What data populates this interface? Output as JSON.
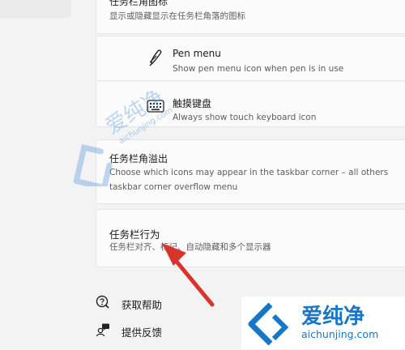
{
  "top_item": {
    "title": "任务栏角图标",
    "desc": "显示或隐藏显示在任务栏角落的图标"
  },
  "pen_menu": {
    "title": "Pen menu",
    "desc": "Show pen menu icon when pen is in use"
  },
  "touch_keyboard": {
    "title": "触摸键盘",
    "desc": "Always show touch keyboard icon"
  },
  "overflow": {
    "title": "任务栏角溢出",
    "desc_line1": "Choose which icons may appear in the taskbar corner – all others",
    "desc_line2": "taskbar corner overflow menu"
  },
  "behavior": {
    "title": "任务栏行为",
    "desc": "任务栏对齐、标记、自动隐藏和多个显示器"
  },
  "help": {
    "get_help": "获取帮助",
    "feedback": "提供反馈"
  },
  "watermark": {
    "top_text": "爱纯净",
    "top_url": "aichunjing.com",
    "brand_name": "爱纯净",
    "brand_url": "aichunjing.com"
  },
  "colors": {
    "arrow": "#d9342b",
    "brand": "#1677c8"
  }
}
